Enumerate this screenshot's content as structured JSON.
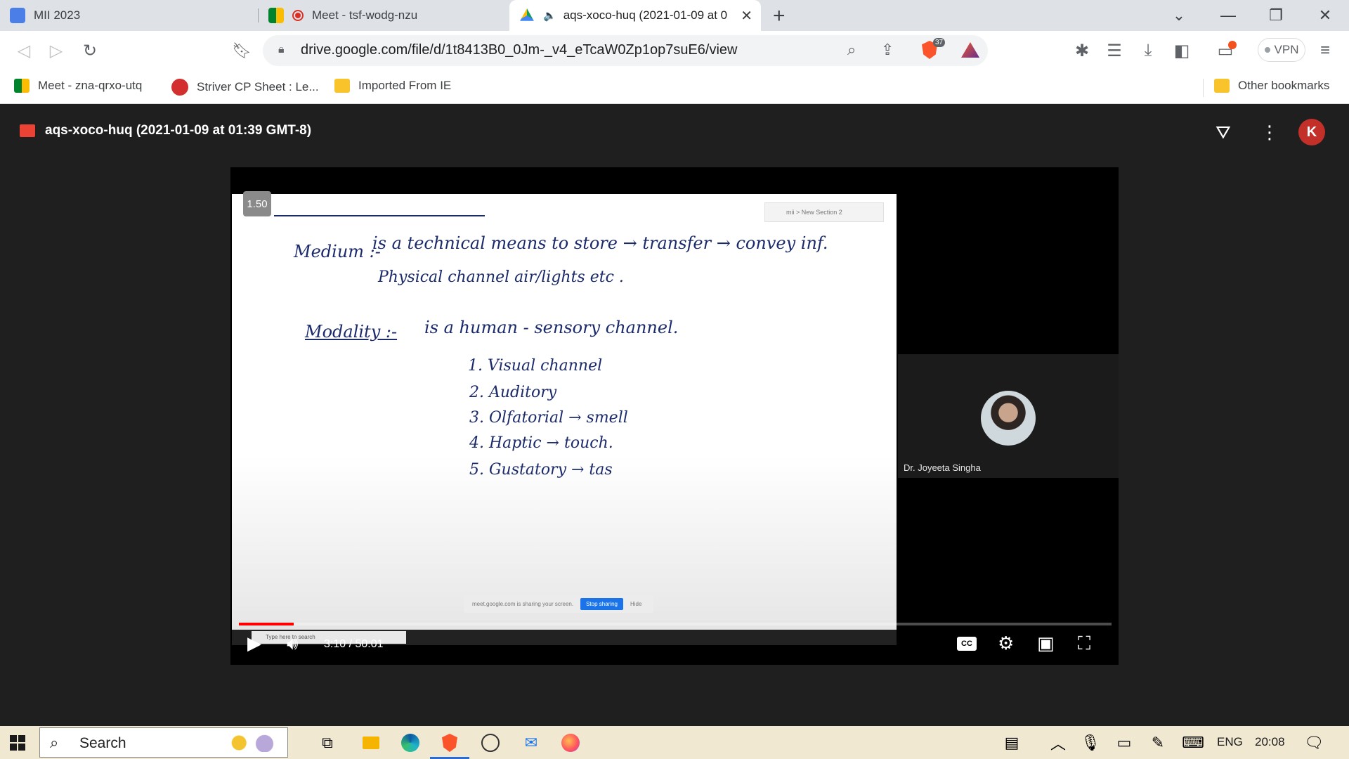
{
  "browser": {
    "tabs": [
      {
        "title": "MII 2023",
        "icon": "person-tab-icon",
        "active": false
      },
      {
        "title": "Meet - tsf-wodg-nzu",
        "icon": "meet-tab-icon",
        "active": false
      },
      {
        "title": "aqs-xoco-huq (2021-01-09 at 0",
        "icon": "drive-tab-icon",
        "active": true
      }
    ],
    "close_tab": "✕",
    "new_tab": "+",
    "url": "drive.google.com/file/d/1t8413B0_0Jm-_v4_eTcaW0Zp1op7suE6/view",
    "brave_badge": "37",
    "vpn_label": "VPN"
  },
  "bookmarks": {
    "items": [
      {
        "label": "Meet - zna-qrxo-utq"
      },
      {
        "label": "Striver CP Sheet : Le..."
      },
      {
        "label": "Imported From IE"
      }
    ],
    "other": "Other bookmarks"
  },
  "viewer": {
    "title": "aqs-xoco-huq (2021-01-09 at 01:39 GMT-8)",
    "avatar_letter": "K"
  },
  "video": {
    "speed": "1.50",
    "time": "3:10 / 50:01",
    "progress": 0.063,
    "cc_label": "CC",
    "participant": "Dr. Joyeeta Singha",
    "slide": {
      "minipanel": "mii > New Section 2",
      "share_text": "meet.google.com is sharing your screen.",
      "stop_sharing": "Stop sharing",
      "hide": "Hide",
      "inner_search": "Type here to search",
      "lines": {
        "medium_head": "Medium :-",
        "medium_def": "is a technical means to store → transfer → convey inf.",
        "medium_sub": "Physical channel      air/lights etc .",
        "modality_head": "Modality :-",
        "modality_def": "is a human - sensory channel.",
        "items": [
          "1.  Visual channel",
          "2.  Auditory",
          "3.  Olfatorial  →  smell",
          "4.  Haptic  →  touch.",
          "5.  Gustatory  →  tas"
        ]
      }
    }
  },
  "taskbar": {
    "search_label": "Search",
    "lang": "ENG",
    "time": "20:08"
  }
}
